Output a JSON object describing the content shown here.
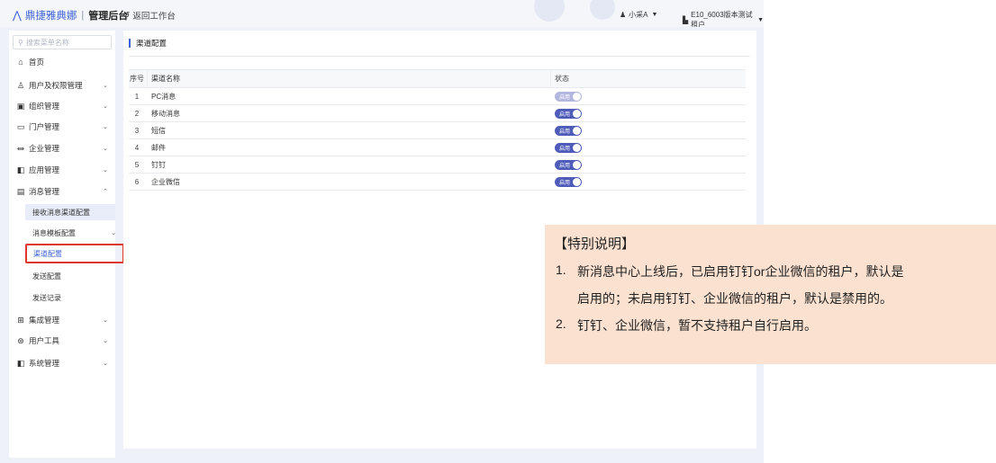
{
  "header": {
    "brand": "鼎捷雅典娜",
    "separator": "|",
    "admin_label": "管理后台",
    "back_label": "返回工作台",
    "user": "小采A",
    "tenant": "E10_6003版本测试租户"
  },
  "sidebar": {
    "search_placeholder": "搜索菜单名称",
    "items": [
      {
        "label": "首页",
        "icon": "home-icon"
      },
      {
        "label": "用户及权限管理",
        "icon": "users-icon"
      },
      {
        "label": "组织管理",
        "icon": "org-icon"
      },
      {
        "label": "门户管理",
        "icon": "portal-icon"
      },
      {
        "label": "企业管理",
        "icon": "building-icon"
      },
      {
        "label": "应用管理",
        "icon": "app-icon"
      },
      {
        "label": "消息管理",
        "icon": "message-icon"
      },
      {
        "label": "集成管理",
        "icon": "grid-icon"
      },
      {
        "label": "用户工具",
        "icon": "tool-icon"
      },
      {
        "label": "系统管理",
        "icon": "system-icon"
      }
    ],
    "message_children": [
      {
        "label": "接收消息渠道配置"
      },
      {
        "label": "消息模板配置"
      },
      {
        "label": "渠道配置"
      },
      {
        "label": "发送配置"
      },
      {
        "label": "发送记录"
      }
    ]
  },
  "page": {
    "title": "渠道配置",
    "columns": {
      "no": "序号",
      "name": "渠道名称",
      "status": "状态"
    },
    "rows": [
      {
        "no": "1",
        "name": "PC消息",
        "switch_label": "启用",
        "enabled": true,
        "disabled": true
      },
      {
        "no": "2",
        "name": "移动消息",
        "switch_label": "启用",
        "enabled": true,
        "disabled": false
      },
      {
        "no": "3",
        "name": "短信",
        "switch_label": "启用",
        "enabled": true,
        "disabled": false
      },
      {
        "no": "4",
        "name": "邮件",
        "switch_label": "启用",
        "enabled": true,
        "disabled": false
      },
      {
        "no": "5",
        "name": "钉钉",
        "switch_label": "启用",
        "enabled": true,
        "disabled": false
      },
      {
        "no": "6",
        "name": "企业微信",
        "switch_label": "启用",
        "enabled": true,
        "disabled": false
      }
    ]
  },
  "note": {
    "title": "【特别说明】",
    "items": [
      {
        "num": "1.",
        "line1": "新消息中心上线后，已启用钉钉or企业微信的租户，默认是",
        "line2": "启用的；未启用钉钉、企业微信的租户，默认是禁用的。"
      },
      {
        "num": "2.",
        "line1": "钉钉、企业微信，暂不支持租户自行启用。"
      }
    ]
  },
  "colors": {
    "accent": "#3b62d6",
    "switch_on": "#4e5bb9",
    "highlight_border": "#e0352b",
    "note_bg": "#fbe1d0"
  }
}
